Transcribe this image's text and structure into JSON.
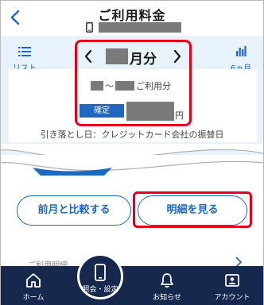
{
  "header": {
    "title": "ご利用料金"
  },
  "toolbar": {
    "list_label": "リスト",
    "six_month_label": "6ヵ月"
  },
  "billing": {
    "month_suffix": "月分",
    "period_tilde": "〜",
    "period_label": "ご利用分",
    "status": "確定",
    "currency": "円",
    "debit_note": "引き落とし日：クレジットカード会社の振替日"
  },
  "actions": {
    "compare_label": "前月と比較する",
    "detail_label": "明細を見る"
  },
  "peek": {
    "text": "ご利用明細"
  },
  "nav": {
    "home": "ホーム",
    "inquiry": "照会・設定",
    "notice": "お知らせ",
    "account": "アカウント"
  },
  "colors": {
    "accent": "#1d68c1",
    "highlight": "#e4001b",
    "nav_bg": "#16284e"
  }
}
